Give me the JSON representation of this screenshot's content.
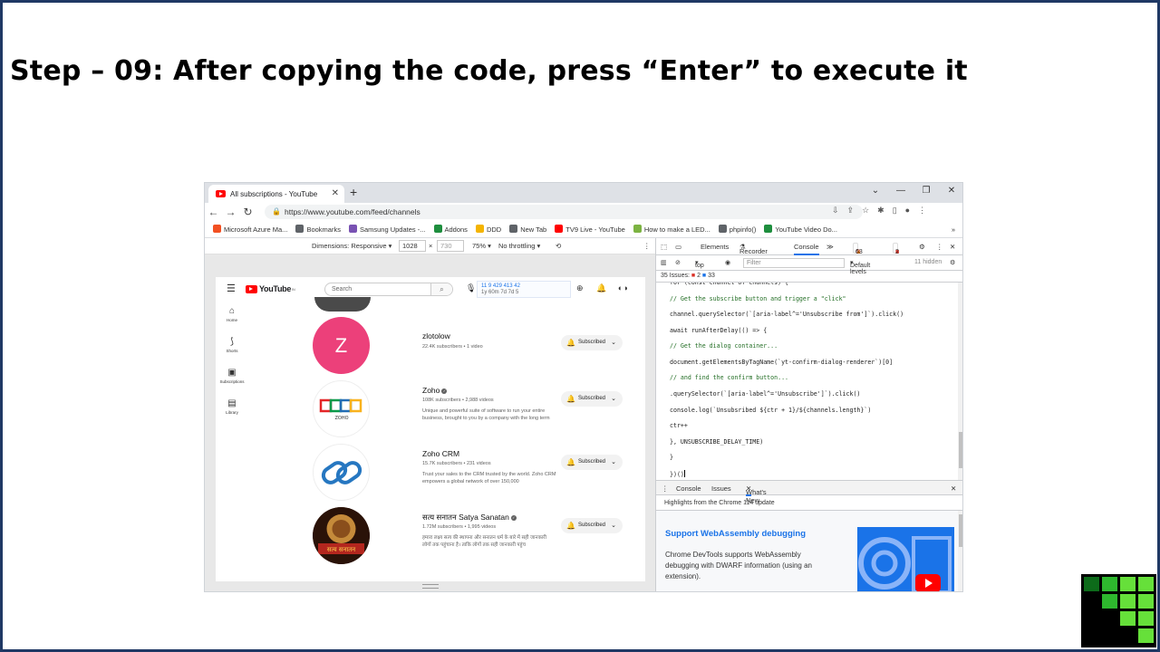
{
  "slide": {
    "title": "Step – 09: After copying the code, press “Enter” to execute it"
  },
  "browser": {
    "tab_title": "All subscriptions - YouTube",
    "url": "https://www.youtube.com/feed/channels",
    "bookmarks": [
      {
        "label": "Microsoft Azure Ma...",
        "icon": "microsoft-icon",
        "color": "#f25022"
      },
      {
        "label": "Bookmarks",
        "icon": "star-icon",
        "color": "#5f6368"
      },
      {
        "label": "Samsung Updates -...",
        "icon": "bootstrap-icon",
        "color": "#7952b3"
      },
      {
        "label": "Addons",
        "icon": "puzzle-icon",
        "color": "#1e8e3e"
      },
      {
        "label": "DDD",
        "icon": "folder-icon",
        "color": "#f4b400"
      },
      {
        "label": "New Tab",
        "icon": "globe-icon",
        "color": "#5f6368"
      },
      {
        "label": "TV9 Live - YouTube",
        "icon": "youtube-icon",
        "color": "#ff0000"
      },
      {
        "label": "How to make a LED...",
        "icon": "leaf-icon",
        "color": "#7cb342"
      },
      {
        "label": "phpinfo()",
        "icon": "globe-icon",
        "color": "#5f6368"
      },
      {
        "label": "YouTube Video Do...",
        "icon": "puzzle-icon",
        "color": "#1e8e3e"
      }
    ],
    "more_bookmarks": "»"
  },
  "device_toolbar": {
    "dimensions_label": "Dimensions: Responsive",
    "width": "1028",
    "times": "×",
    "height": "730",
    "zoom": "75%",
    "throttling": "No throttling"
  },
  "youtube": {
    "brand": "YouTube",
    "region": "IN",
    "search_placeholder": "Search",
    "ext_line1": "11    9    429  413  42",
    "ext_line2": "1y  60m  7d   7d   5",
    "sidebar": [
      {
        "label": "Home",
        "icon": "home-icon"
      },
      {
        "label": "Shorts",
        "icon": "shorts-icon"
      },
      {
        "label": "Subscriptions",
        "icon": "subscriptions-icon"
      },
      {
        "label": "Library",
        "icon": "library-icon"
      }
    ],
    "channels": [
      {
        "name": "zlotolow",
        "meta": "22.4K subscribers • 1 video",
        "desc": "",
        "avatar_letter": "Z",
        "avatar_color": "#ec407a",
        "verified": false,
        "button": "Subscribed"
      },
      {
        "name": "Zoho",
        "meta": "108K subscribers • 2,988 videos",
        "desc": "Unique and powerful suite of software to run your entire business, brought to you by a company with the long term",
        "avatar_letter": "",
        "avatar_color": "#ffffff",
        "logo_text": "ZOHO",
        "verified": true,
        "button": "Subscribed"
      },
      {
        "name": "Zoho CRM",
        "meta": "15.7K subscribers • 231 videos",
        "desc": "Trust your sales to the CRM trusted by the world. Zoho CRM empowers a global network of over 150,000",
        "avatar_letter": "",
        "avatar_color": "#ffffff",
        "verified": false,
        "button": "Subscribed"
      },
      {
        "name": "सत्य सनातन Satya Sanatan",
        "meta": "1.72M subscribers • 1,995 videos",
        "desc": "हमारा लक्ष्य सत्य की स्थापना और सनातन धर्म के बारे में सही जानकारी लोगों तक पहुंचाना है। ताकि लोगों तक सही जानकारी पहुंच",
        "avatar_letter": "",
        "avatar_color": "#3b1a0e",
        "logo_text": "सत्य सनातन",
        "verified": true,
        "button": "Subscribed"
      }
    ]
  },
  "devtools": {
    "tabs": [
      "Elements",
      "Recorder",
      "Console"
    ],
    "active_tab": "Console",
    "errors": "6",
    "warnings": "63",
    "info": "2",
    "context": "top",
    "filter_placeholder": "Filter",
    "levels": "Default levels",
    "hidden": "11 hidden",
    "issues_label": "35 Issues:",
    "issues_errors": "2",
    "issues_info": "33",
    "code_lines": [
      "for (const channel of channels) {",
      "// Get the subscribe button and trigger a \"click\"",
      "channel.querySelector(`[aria-label^='Unsubscribe from']`).click()",
      "await runAfterDelay(() => {",
      "// Get the dialog container...",
      "document.getElementsByTagName(`yt-confirm-dialog-renderer`)[0]",
      "// and find the confirm button...",
      ".querySelector(`[aria-label^='Unsubscribe']`).click()",
      "console.log(`Unsubsribed ${ctr + 1}/${channels.length}`)",
      "ctr++",
      "}, UNSUBSCRIBE_DELAY_TIME)",
      "}",
      "})()"
    ],
    "drawer_tabs": [
      "Console",
      "Issues",
      "What's New"
    ],
    "drawer_active": "What's New",
    "highlights": "Highlights from the Chrome 114 update",
    "whats_new_title": "Support WebAssembly debugging",
    "whats_new_body": "Chrome DevTools supports WebAssembly debugging with DWARF information (using an extension)."
  },
  "colors": {
    "slide_border": "#1f3864",
    "accent": "#1a73e8",
    "youtube_red": "#ff0000",
    "logo_green_light": "#66e03a",
    "logo_green_dark": "#0d6b1a"
  }
}
